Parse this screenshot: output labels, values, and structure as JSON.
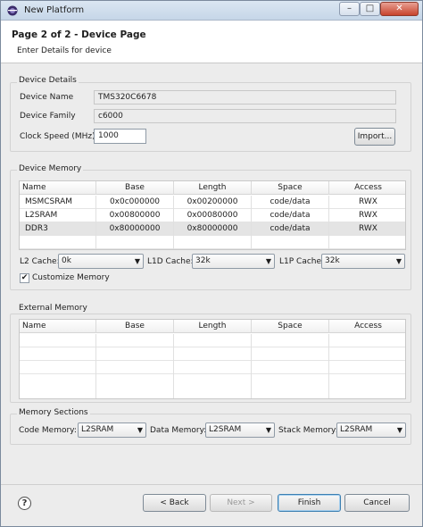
{
  "window": {
    "title": "New Platform"
  },
  "header": {
    "title": "Page 2 of 2 - Device Page",
    "subtitle": "Enter Details for device"
  },
  "device_details": {
    "group_title": "Device Details",
    "device_name_label": "Device Name",
    "device_name_value": "TMS320C6678",
    "device_family_label": "Device Family",
    "device_family_value": "c6000",
    "clock_speed_label": "Clock Speed (MHz)",
    "clock_speed_value": "1000",
    "import_button": "Import..."
  },
  "device_memory": {
    "group_title": "Device Memory",
    "columns": [
      "Name",
      "Base",
      "Length",
      "Space",
      "Access"
    ],
    "rows": [
      [
        "MSMCSRAM",
        "0x0c000000",
        "0x00200000",
        "code/data",
        "RWX"
      ],
      [
        "L2SRAM",
        "0x00800000",
        "0x00080000",
        "code/data",
        "RWX"
      ],
      [
        "DDR3",
        "0x80000000",
        "0x80000000",
        "code/data",
        "RWX"
      ]
    ],
    "l2_cache_label": "L2 Cache:",
    "l2_cache_value": "0k",
    "l1d_cache_label": "L1D Cache:",
    "l1d_cache_value": "32k",
    "l1p_cache_label": "L1P Cache:",
    "l1p_cache_value": "32k",
    "customize_label": "Customize Memory",
    "customize_checked": true
  },
  "external_memory": {
    "group_title": "External Memory",
    "columns": [
      "Name",
      "Base",
      "Length",
      "Space",
      "Access"
    ]
  },
  "memory_sections": {
    "group_title": "Memory Sections",
    "code_label": "Code Memory:",
    "code_value": "L2SRAM",
    "data_label": "Data Memory:",
    "data_value": "L2SRAM",
    "stack_label": "Stack Memory:",
    "stack_value": "L2SRAM"
  },
  "footer": {
    "back": "< Back",
    "next": "Next >",
    "finish": "Finish",
    "cancel": "Cancel",
    "help_glyph": "?"
  },
  "window_buttons": {
    "minimize": "–",
    "maximize": "□",
    "close": "✕"
  }
}
